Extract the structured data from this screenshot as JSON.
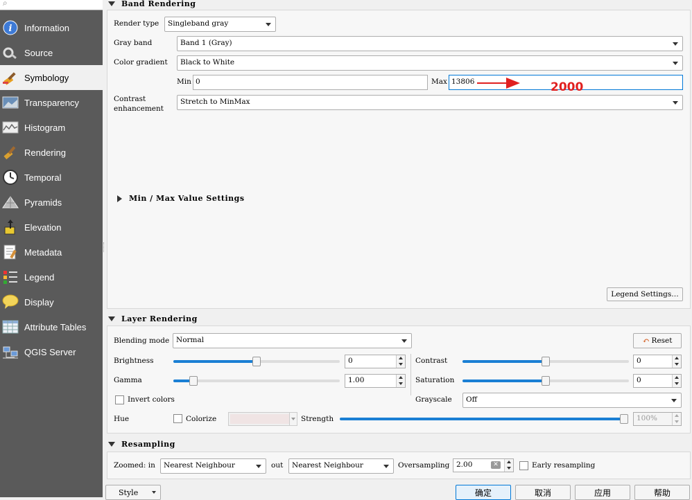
{
  "sidebar": {
    "search_icon": "search-icon",
    "items": [
      {
        "label": "Information",
        "icon": "information-icon"
      },
      {
        "label": "Source",
        "icon": "source-icon"
      },
      {
        "label": "Symbology",
        "icon": "symbology-brush-icon"
      },
      {
        "label": "Transparency",
        "icon": "transparency-icon"
      },
      {
        "label": "Histogram",
        "icon": "histogram-icon"
      },
      {
        "label": "Rendering",
        "icon": "rendering-icon"
      },
      {
        "label": "Temporal",
        "icon": "clock-icon"
      },
      {
        "label": "Pyramids",
        "icon": "pyramids-icon"
      },
      {
        "label": "Elevation",
        "icon": "elevation-icon"
      },
      {
        "label": "Metadata",
        "icon": "metadata-icon"
      },
      {
        "label": "Legend",
        "icon": "legend-icon"
      },
      {
        "label": "Display",
        "icon": "display-speech-icon"
      },
      {
        "label": "Attribute Tables",
        "icon": "table-icon"
      },
      {
        "label": "QGIS Server",
        "icon": "server-icon"
      }
    ],
    "active_index": 2
  },
  "band_rendering": {
    "title": "Band Rendering",
    "render_type_label": "Render type",
    "render_type_value": "Singleband gray",
    "gray_band_label": "Gray band",
    "gray_band_value": "Band 1 (Gray)",
    "color_gradient_label": "Color gradient",
    "color_gradient_value": "Black to White",
    "min_label": "Min",
    "min_value": "0",
    "max_label": "Max",
    "max_value": "13806",
    "contrast_label_1": "Contrast",
    "contrast_label_2": "enhancement",
    "contrast_value": "Stretch to MinMax",
    "minmax_settings": "Min / Max Value Settings",
    "legend_settings": "Legend Settings…"
  },
  "annotation": {
    "text": "2000",
    "color": "#e02020"
  },
  "layer_rendering": {
    "title": "Layer Rendering",
    "blending_label": "Blending mode",
    "blending_value": "Normal",
    "reset": "Reset",
    "brightness_label": "Brightness",
    "brightness_value": "0",
    "brightness_level": 0.5,
    "contrast_label": "Contrast",
    "contrast_value": "0",
    "contrast_level": 0.5,
    "gamma_label": "Gamma",
    "gamma_value": "1.00",
    "gamma_level": 0.1,
    "saturation_label": "Saturation",
    "saturation_value": "0",
    "saturation_level": 0.5,
    "invert_label": "Invert colors",
    "grayscale_label": "Grayscale",
    "grayscale_value": "Off",
    "hue_label": "Hue",
    "colorize_label": "Colorize",
    "strength_label": "Strength",
    "strength_value": "100%",
    "strength_level": 1.0
  },
  "resampling": {
    "title": "Resampling",
    "zoomed_in_label": "Zoomed: in",
    "zoomed_in_value": "Nearest Neighbour",
    "out_label": "out",
    "out_value": "Nearest Neighbour",
    "oversampling_label": "Oversampling",
    "oversampling_value": "2.00",
    "early_label": "Early resampling"
  },
  "footer": {
    "style": "Style",
    "ok": "确定",
    "cancel": "取消",
    "apply": "应用",
    "help": "帮助"
  },
  "colors": {
    "accent": "#1a7fd4",
    "sidebar_bg": "#5a5a5a"
  }
}
